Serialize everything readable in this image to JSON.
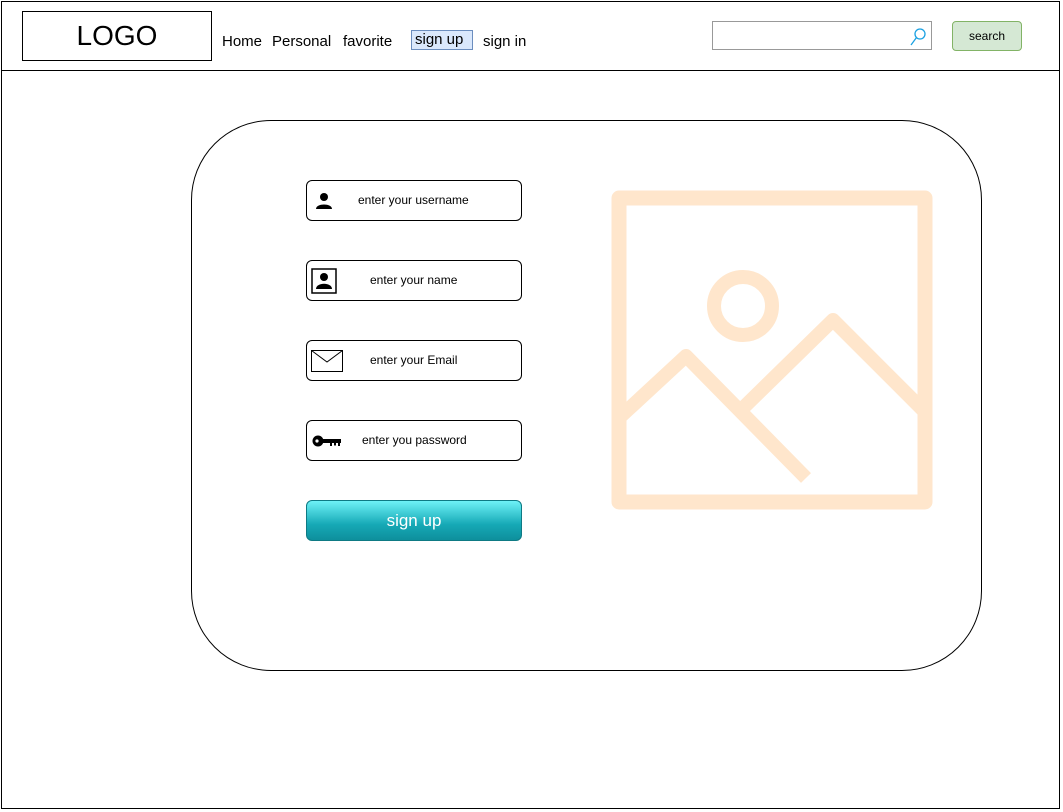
{
  "header": {
    "logo": "LOGO",
    "nav": [
      {
        "label": "Home"
      },
      {
        "label": "Personal"
      },
      {
        "label": "favorite"
      },
      {
        "label": "sign up",
        "active": true
      },
      {
        "label": "sign in"
      }
    ],
    "search": {
      "placeholder": "",
      "value": "",
      "button_label": "search",
      "icon": "magnifier-icon"
    }
  },
  "form": {
    "fields": [
      {
        "placeholder": "enter your username",
        "icon": "user-icon"
      },
      {
        "placeholder": "enter your name",
        "icon": "user-card-icon"
      },
      {
        "placeholder": "enter your Email",
        "icon": "envelope-icon"
      },
      {
        "placeholder": "enter you password",
        "icon": "key-icon"
      }
    ],
    "submit_label": "sign up"
  },
  "image_placeholder": {
    "icon": "image-icon"
  },
  "colors": {
    "nav_active_bg": "#dae8fc",
    "search_button_bg": "#d5e8d4",
    "signup_button": "#16a9b6",
    "image_placeholder": "#ffe6cc"
  }
}
